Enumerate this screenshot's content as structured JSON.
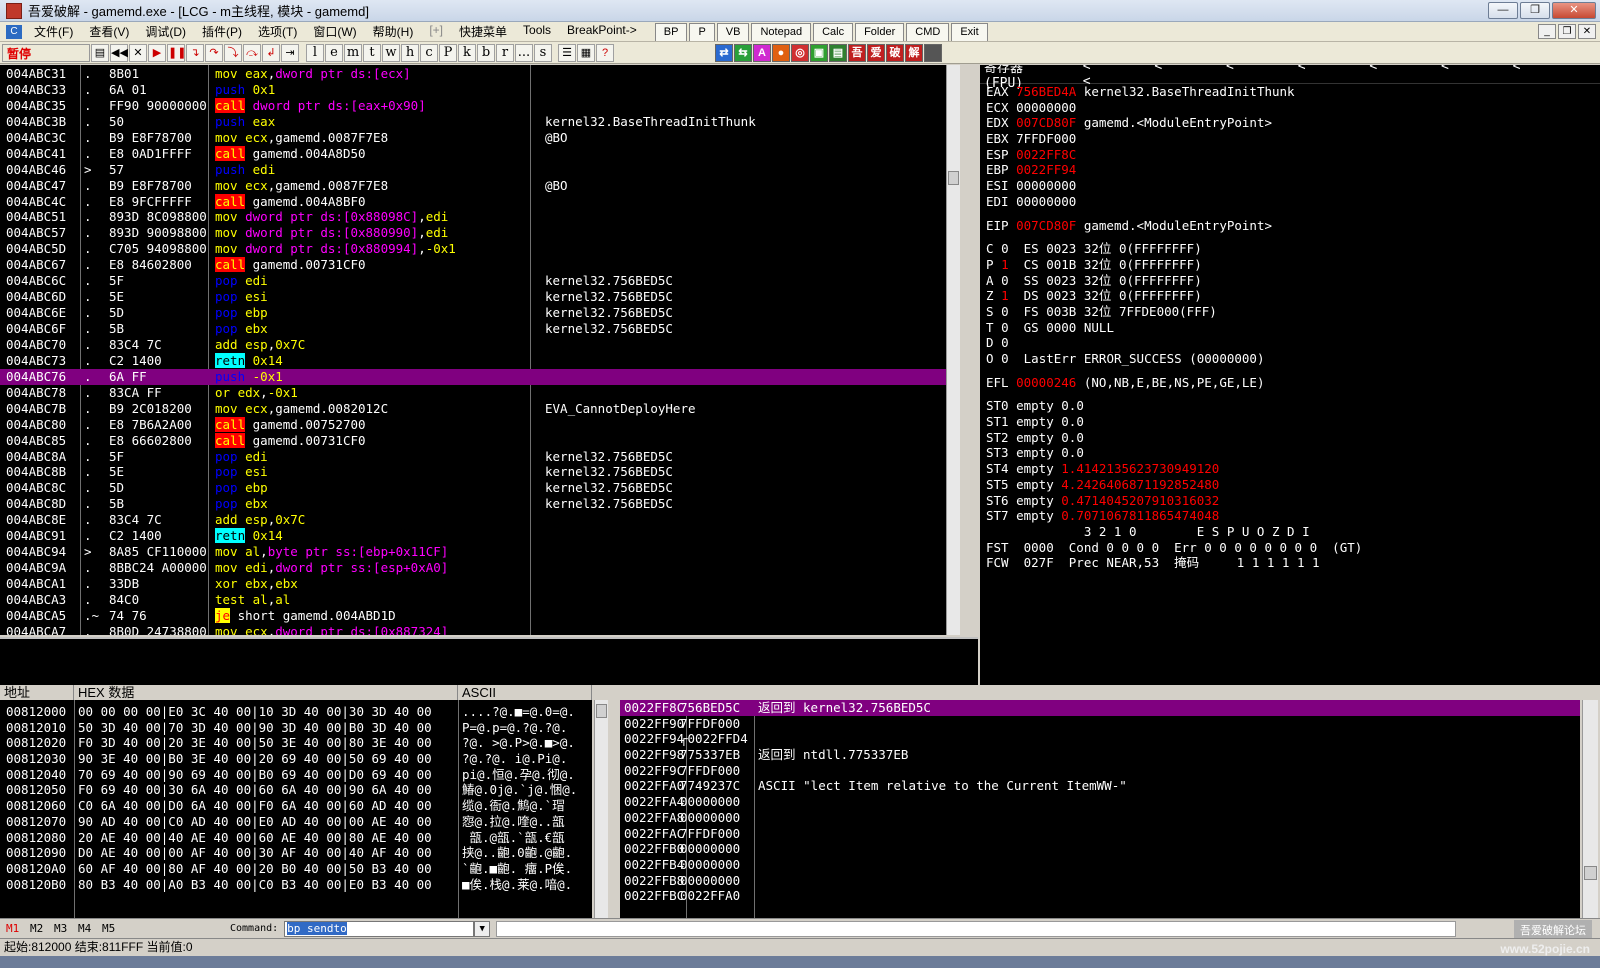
{
  "window": {
    "title": "吾爱破解 - gamemd.exe - [LCG - m主线程, 模块 - gamemd]",
    "minimize": "—",
    "maximize": "❐",
    "close": "✕"
  },
  "menu": {
    "icon": "C",
    "items": [
      "文件(F)",
      "查看(V)",
      "调试(D)",
      "插件(P)",
      "选项(T)",
      "窗口(W)",
      "帮助(H)",
      "[+]",
      "快捷菜单",
      "Tools",
      "BreakPoint->"
    ],
    "tabs": [
      "BP",
      "P",
      "VB",
      "Notepad",
      "Calc",
      "Folder",
      "CMD",
      "Exit"
    ]
  },
  "toolbar": {
    "state": "暂停",
    "letters": [
      "l",
      "e",
      "m",
      "t",
      "w",
      "h",
      "c",
      "P",
      "k",
      "b",
      "r",
      "...",
      "s"
    ]
  },
  "cpu": {
    "rows": [
      {
        "addr": "004ABC31",
        "mark": ".",
        "hex": "8B01",
        "op": "mov",
        "opclass": "op-mov",
        "args": [
          [
            "eax",
            "a-reg"
          ],
          [
            ",",
            "a-text"
          ],
          [
            "dword ptr ds:[ecx]",
            "a-mem"
          ]
        ],
        "cmt": ""
      },
      {
        "addr": "004ABC33",
        "mark": ".",
        "hex": "6A 01",
        "op": "push",
        "opclass": "op-push",
        "args": [
          [
            "0x1",
            "a-imm"
          ]
        ],
        "cmt": ""
      },
      {
        "addr": "004ABC35",
        "mark": ".",
        "hex": "FF90 90000000",
        "op": "call",
        "opclass": "op-call",
        "args": [
          [
            "dword ptr ds:[eax+0x90]",
            "a-mem"
          ]
        ],
        "cmt": ""
      },
      {
        "addr": "004ABC3B",
        "mark": ".",
        "hex": "50",
        "op": "push",
        "opclass": "op-push",
        "args": [
          [
            "eax",
            "a-reg"
          ]
        ],
        "cmt": "kernel32.BaseThreadInitThunk"
      },
      {
        "addr": "004ABC3C",
        "mark": ".",
        "hex": "B9 E8F78700",
        "op": "mov",
        "opclass": "op-mov",
        "args": [
          [
            "ecx",
            "a-reg"
          ],
          [
            ",gamemd.0087F7E8",
            "a-text"
          ]
        ],
        "cmt": "@BO"
      },
      {
        "addr": "004ABC41",
        "mark": ".",
        "hex": "E8 0AD1FFFF",
        "op": "call",
        "opclass": "op-call",
        "args": [
          [
            "gamemd.004A8D50",
            "a-text"
          ]
        ],
        "cmt": ""
      },
      {
        "addr": "004ABC46",
        "mark": ">",
        "hex": "57",
        "op": "push",
        "opclass": "op-push",
        "args": [
          [
            "edi",
            "a-reg"
          ]
        ],
        "cmt": ""
      },
      {
        "addr": "004ABC47",
        "mark": ".",
        "hex": "B9 E8F78700",
        "op": "mov",
        "opclass": "op-mov",
        "args": [
          [
            "ecx",
            "a-reg"
          ],
          [
            ",gamemd.0087F7E8",
            "a-text"
          ]
        ],
        "cmt": "@BO"
      },
      {
        "addr": "004ABC4C",
        "mark": ".",
        "hex": "E8 9FCFFFFF",
        "op": "call",
        "opclass": "op-call",
        "args": [
          [
            "gamemd.004A8BF0",
            "a-text"
          ]
        ],
        "cmt": ""
      },
      {
        "addr": "004ABC51",
        "mark": ".",
        "hex": "893D 8C098800",
        "op": "mov",
        "opclass": "op-mov",
        "args": [
          [
            "dword ptr ds:[0x88098C]",
            "a-mem"
          ],
          [
            ",",
            "a-text"
          ],
          [
            "edi",
            "a-reg"
          ]
        ],
        "cmt": ""
      },
      {
        "addr": "004ABC57",
        "mark": ".",
        "hex": "893D 90098800",
        "op": "mov",
        "opclass": "op-mov",
        "args": [
          [
            "dword ptr ds:[0x880990]",
            "a-mem"
          ],
          [
            ",",
            "a-text"
          ],
          [
            "edi",
            "a-reg"
          ]
        ],
        "cmt": ""
      },
      {
        "addr": "004ABC5D",
        "mark": ".",
        "hex": "C705 94098800",
        "op": "mov",
        "opclass": "op-mov",
        "args": [
          [
            "dword ptr ds:[0x880994]",
            "a-mem"
          ],
          [
            ",",
            "a-text"
          ],
          [
            "-0x1",
            "a-imm"
          ]
        ],
        "cmt": ""
      },
      {
        "addr": "004ABC67",
        "mark": ".",
        "hex": "E8 84602800",
        "op": "call",
        "opclass": "op-call",
        "args": [
          [
            "gamemd.00731CF0",
            "a-text"
          ]
        ],
        "cmt": ""
      },
      {
        "addr": "004ABC6C",
        "mark": ".",
        "hex": "5F",
        "op": "pop",
        "opclass": "op-pop",
        "args": [
          [
            "edi",
            "a-reg"
          ]
        ],
        "cmt": "kernel32.756BED5C"
      },
      {
        "addr": "004ABC6D",
        "mark": ".",
        "hex": "5E",
        "op": "pop",
        "opclass": "op-pop",
        "args": [
          [
            "esi",
            "a-reg"
          ]
        ],
        "cmt": "kernel32.756BED5C"
      },
      {
        "addr": "004ABC6E",
        "mark": ".",
        "hex": "5D",
        "op": "pop",
        "opclass": "op-pop",
        "args": [
          [
            "ebp",
            "a-reg"
          ]
        ],
        "cmt": "kernel32.756BED5C"
      },
      {
        "addr": "004ABC6F",
        "mark": ".",
        "hex": "5B",
        "op": "pop",
        "opclass": "op-pop",
        "args": [
          [
            "ebx",
            "a-reg"
          ]
        ],
        "cmt": "kernel32.756BED5C"
      },
      {
        "addr": "004ABC70",
        "mark": ".",
        "hex": "83C4 7C",
        "op": "add",
        "opclass": "op-mov",
        "args": [
          [
            "esp",
            "a-reg"
          ],
          [
            ",",
            "a-text"
          ],
          [
            "0x7C",
            "a-imm"
          ]
        ],
        "cmt": ""
      },
      {
        "addr": "004ABC73",
        "mark": ".",
        "hex": "C2 1400",
        "op": "retn",
        "opclass": "op-retn",
        "args": [
          [
            "0x14",
            "a-imm"
          ]
        ],
        "cmt": ""
      },
      {
        "addr": "004ABC76",
        "mark": ".",
        "hex": "6A FF",
        "op": "push",
        "opclass": "op-push",
        "args": [
          [
            "-0x1",
            "a-imm"
          ]
        ],
        "cmt": "",
        "sel": true
      },
      {
        "addr": "004ABC78",
        "mark": ".",
        "hex": "83CA FF",
        "op": "or",
        "opclass": "op-mov",
        "args": [
          [
            "edx",
            "a-reg"
          ],
          [
            ",",
            "a-text"
          ],
          [
            "-0x1",
            "a-imm"
          ]
        ],
        "cmt": ""
      },
      {
        "addr": "004ABC7B",
        "mark": ".",
        "hex": "B9 2C018200",
        "op": "mov",
        "opclass": "op-mov",
        "args": [
          [
            "ecx",
            "a-reg"
          ],
          [
            ",gamemd.0082012C",
            "a-text"
          ]
        ],
        "cmt": "EVA_CannotDeployHere"
      },
      {
        "addr": "004ABC80",
        "mark": ".",
        "hex": "E8 7B6A2A00",
        "op": "call",
        "opclass": "op-call",
        "args": [
          [
            "gamemd.00752700",
            "a-text"
          ]
        ],
        "cmt": ""
      },
      {
        "addr": "004ABC85",
        "mark": ".",
        "hex": "E8 66602800",
        "op": "call",
        "opclass": "op-call",
        "args": [
          [
            "gamemd.00731CF0",
            "a-text"
          ]
        ],
        "cmt": ""
      },
      {
        "addr": "004ABC8A",
        "mark": ".",
        "hex": "5F",
        "op": "pop",
        "opclass": "op-pop",
        "args": [
          [
            "edi",
            "a-reg"
          ]
        ],
        "cmt": "kernel32.756BED5C"
      },
      {
        "addr": "004ABC8B",
        "mark": ".",
        "hex": "5E",
        "op": "pop",
        "opclass": "op-pop",
        "args": [
          [
            "esi",
            "a-reg"
          ]
        ],
        "cmt": "kernel32.756BED5C"
      },
      {
        "addr": "004ABC8C",
        "mark": ".",
        "hex": "5D",
        "op": "pop",
        "opclass": "op-pop",
        "args": [
          [
            "ebp",
            "a-reg"
          ]
        ],
        "cmt": "kernel32.756BED5C"
      },
      {
        "addr": "004ABC8D",
        "mark": ".",
        "hex": "5B",
        "op": "pop",
        "opclass": "op-pop",
        "args": [
          [
            "ebx",
            "a-reg"
          ]
        ],
        "cmt": "kernel32.756BED5C"
      },
      {
        "addr": "004ABC8E",
        "mark": ".",
        "hex": "83C4 7C",
        "op": "add",
        "opclass": "op-mov",
        "args": [
          [
            "esp",
            "a-reg"
          ],
          [
            ",",
            "a-text"
          ],
          [
            "0x7C",
            "a-imm"
          ]
        ],
        "cmt": ""
      },
      {
        "addr": "004ABC91",
        "mark": ".",
        "hex": "C2 1400",
        "op": "retn",
        "opclass": "op-retn",
        "args": [
          [
            "0x14",
            "a-imm"
          ]
        ],
        "cmt": ""
      },
      {
        "addr": "004ABC94",
        "mark": ">",
        "hex": "8A85 CF110000",
        "op": "mov",
        "opclass": "op-mov",
        "args": [
          [
            "al",
            "a-reg"
          ],
          [
            ",",
            "a-text"
          ],
          [
            "byte ptr ss:[ebp+0x11CF]",
            "a-mem"
          ]
        ],
        "cmt": ""
      },
      {
        "addr": "004ABC9A",
        "mark": ".",
        "hex": "8BBC24 A00000",
        "op": "mov",
        "opclass": "op-mov",
        "args": [
          [
            "edi",
            "a-reg"
          ],
          [
            ",",
            "a-text"
          ],
          [
            "dword ptr ss:[esp+0xA0]",
            "a-mem"
          ]
        ],
        "cmt": ""
      },
      {
        "addr": "004ABCA1",
        "mark": ".",
        "hex": "33DB",
        "op": "xor",
        "opclass": "op-mov",
        "args": [
          [
            "ebx",
            "a-reg"
          ],
          [
            ",",
            "a-text"
          ],
          [
            "ebx",
            "a-reg"
          ]
        ],
        "cmt": ""
      },
      {
        "addr": "004ABCA3",
        "mark": ".",
        "hex": "84C0",
        "op": "test",
        "opclass": "op-mov",
        "args": [
          [
            "al",
            "a-reg"
          ],
          [
            ",",
            "a-text"
          ],
          [
            "al",
            "a-reg"
          ]
        ],
        "cmt": ""
      },
      {
        "addr": "004ABCA5",
        "mark": ".~",
        "hex": "74 76",
        "op": "je",
        "opclass": "op-jcc",
        "args": [
          [
            "short gamemd.004ABD1D",
            "a-text"
          ]
        ],
        "cmt": ""
      },
      {
        "addr": "004ABCA7",
        "mark": ".",
        "hex": "8B0D 24738800",
        "op": "mov",
        "opclass": "op-mov",
        "args": [
          [
            "ecx",
            "a-reg"
          ],
          [
            ",",
            "a-text"
          ],
          [
            "dword ptr ds:[0x887324]",
            "a-mem"
          ]
        ],
        "cmt": ""
      }
    ]
  },
  "registers": {
    "header": "寄存器 (FPU)",
    "arrows": "< < < < < < < <",
    "gp": [
      {
        "name": "EAX",
        "value": "756BED4A",
        "changed": true,
        "note": "kernel32.BaseThreadInitThunk"
      },
      {
        "name": "ECX",
        "value": "00000000",
        "changed": false,
        "note": ""
      },
      {
        "name": "EDX",
        "value": "007CD80F",
        "changed": true,
        "note": "gamemd.<ModuleEntryPoint>"
      },
      {
        "name": "EBX",
        "value": "7FFDF000",
        "changed": false,
        "note": ""
      },
      {
        "name": "ESP",
        "value": "0022FF8C",
        "changed": true,
        "note": ""
      },
      {
        "name": "EBP",
        "value": "0022FF94",
        "changed": true,
        "note": ""
      },
      {
        "name": "ESI",
        "value": "00000000",
        "changed": false,
        "note": ""
      },
      {
        "name": "EDI",
        "value": "00000000",
        "changed": false,
        "note": ""
      }
    ],
    "eip": {
      "name": "EIP",
      "value": "007CD80F",
      "note": "gamemd.<ModuleEntryPoint>"
    },
    "flags": [
      {
        "f": "C",
        "v": "0",
        "vchanged": false,
        "seg": "ES 0023 32位 0(FFFFFFFF)"
      },
      {
        "f": "P",
        "v": "1",
        "vchanged": true,
        "seg": "CS 001B 32位 0(FFFFFFFF)"
      },
      {
        "f": "A",
        "v": "0",
        "vchanged": false,
        "seg": "SS 0023 32位 0(FFFFFFFF)"
      },
      {
        "f": "Z",
        "v": "1",
        "vchanged": true,
        "seg": "DS 0023 32位 0(FFFFFFFF)"
      },
      {
        "f": "S",
        "v": "0",
        "vchanged": false,
        "seg": "FS 003B 32位 7FFDE000(FFF)"
      },
      {
        "f": "T",
        "v": "0",
        "vchanged": false,
        "seg": "GS 0000 NULL"
      },
      {
        "f": "D",
        "v": "0",
        "vchanged": false,
        "seg": ""
      },
      {
        "f": "O",
        "v": "0",
        "vchanged": false,
        "seg": "LastErr ERROR_SUCCESS (00000000)"
      }
    ],
    "efl": {
      "name": "EFL",
      "value": "00000246",
      "note": "(NO,NB,E,BE,NS,PE,GE,LE)"
    },
    "fpu": [
      {
        "name": "ST0",
        "state": "empty",
        "value": "0.0",
        "changed": false
      },
      {
        "name": "ST1",
        "state": "empty",
        "value": "0.0",
        "changed": false
      },
      {
        "name": "ST2",
        "state": "empty",
        "value": "0.0",
        "changed": false
      },
      {
        "name": "ST3",
        "state": "empty",
        "value": "0.0",
        "changed": false
      },
      {
        "name": "ST4",
        "state": "empty",
        "value": "1.4142135623730949120",
        "changed": true
      },
      {
        "name": "ST5",
        "state": "empty",
        "value": "4.2426406871192852480",
        "changed": true
      },
      {
        "name": "ST6",
        "state": "empty",
        "value": "0.4714045207910316032",
        "changed": true
      },
      {
        "name": "ST7",
        "state": "empty",
        "value": "0.7071067811865474048",
        "changed": true
      }
    ],
    "fpu_bits_header": "             3 2 1 0        E S P U O Z D I",
    "fst": "FST  0000  Cond 0 0 0 0  Err 0 0 0 0 0 0 0 0  (GT)",
    "fcw": "FCW  027F  Prec NEAR,53  掩码     1 1 1 1 1 1"
  },
  "dump": {
    "headers": [
      "地址",
      "HEX 数据",
      "ASCII"
    ],
    "rows": [
      {
        "addr": "00812000",
        "hex": "00 00 00 00|E0 3C 40 00|10 3D 40 00|30 3D 40 00",
        "ascii": "....?@.■=@.0=@."
      },
      {
        "addr": "00812010",
        "hex": "50 3D 40 00|70 3D 40 00|90 3D 40 00|B0 3D 40 00",
        "ascii": "P=@.p=@.?@.?@."
      },
      {
        "addr": "00812020",
        "hex": "F0 3D 40 00|20 3E 40 00|50 3E 40 00|80 3E 40 00",
        "ascii": "?@. >@.P>@.■>@."
      },
      {
        "addr": "00812030",
        "hex": "90 3E 40 00|B0 3E 40 00|20 69 40 00|50 69 40 00",
        "ascii": "?@.?@. i@.Pi@."
      },
      {
        "addr": "00812040",
        "hex": "70 69 40 00|90 69 40 00|B0 69 40 00|D0 69 40 00",
        "ascii": "pi@.恒@.孕@.彻@."
      },
      {
        "addr": "00812050",
        "hex": "F0 69 40 00|30 6A 40 00|60 6A 40 00|90 6A 40 00",
        "ascii": "鰆@.0j@.`j@.悃@."
      },
      {
        "addr": "00812060",
        "hex": "C0 6A 40 00|D0 6A 40 00|F0 6A 40 00|60 AD 40 00",
        "ascii": "缆@.衙@.鹪@.`瑁"
      },
      {
        "addr": "00812070",
        "hex": "90 AD 40 00|C0 AD 40 00|E0 AD 40 00|00 AE 40 00",
        "ascii": "惌@.拉@.喹@..瓿"
      },
      {
        "addr": "00812080",
        "hex": "20 AE 40 00|40 AE 40 00|60 AE 40 00|80 AE 40 00",
        "ascii": " 瓿.@瓿.`瓿.€瓿"
      },
      {
        "addr": "00812090",
        "hex": "D0 AE 40 00|00 AF 40 00|30 AF 40 00|40 AF 40 00",
        "ascii": "挟@..齙.0齙.@齙."
      },
      {
        "addr": "008120A0",
        "hex": "60 AF 40 00|80 AF 40 00|20 B0 40 00|50 B3 40 00",
        "ascii": "`齙.■齙. 癅.P俟."
      },
      {
        "addr": "008120B0",
        "hex": "80 B3 40 00|A0 B3 40 00|C0 B3 40 00|E0 B3 40 00",
        "ascii": "■俟.栈@.莱@.喑@."
      }
    ]
  },
  "stack": {
    "rows": [
      {
        "addr": "0022FF8C",
        "val": "756BED5C",
        "cmt": "返回到 kernel32.756BED5C",
        "sel": true
      },
      {
        "addr": "0022FF90",
        "val": "7FFDF000",
        "cmt": ""
      },
      {
        "addr": "0022FF94",
        "val": "┌0022FFD4",
        "cmt": ""
      },
      {
        "addr": "0022FF98",
        "val": "775337EB",
        "cmt": "返回到 ntdll.775337EB"
      },
      {
        "addr": "0022FF9C",
        "val": "7FFDF000",
        "cmt": ""
      },
      {
        "addr": "0022FFA0",
        "val": "7749237C",
        "cmt": "ASCII \"lect Item relative to the Current ItemWW-\""
      },
      {
        "addr": "0022FFA4",
        "val": "00000000",
        "cmt": ""
      },
      {
        "addr": "0022FFA8",
        "val": "00000000",
        "cmt": ""
      },
      {
        "addr": "0022FFAC",
        "val": "7FFDF000",
        "cmt": ""
      },
      {
        "addr": "0022FFB0",
        "val": "00000000",
        "cmt": ""
      },
      {
        "addr": "0022FFB4",
        "val": "00000000",
        "cmt": ""
      },
      {
        "addr": "0022FFB8",
        "val": "00000000",
        "cmt": ""
      },
      {
        "addr": "0022FFBC",
        "val": "0022FFA0",
        "cmt": ""
      }
    ]
  },
  "cmdbar": {
    "marks": [
      "M1",
      "M2",
      "M3",
      "M4",
      "M5"
    ],
    "label": "Command:",
    "value": "bp sendto",
    "watermark": "吾爱破解论坛"
  },
  "status": {
    "text": "起始:812000 结束:811FFF 当前值:0"
  },
  "watermark_url": "www.52pojie.cn"
}
